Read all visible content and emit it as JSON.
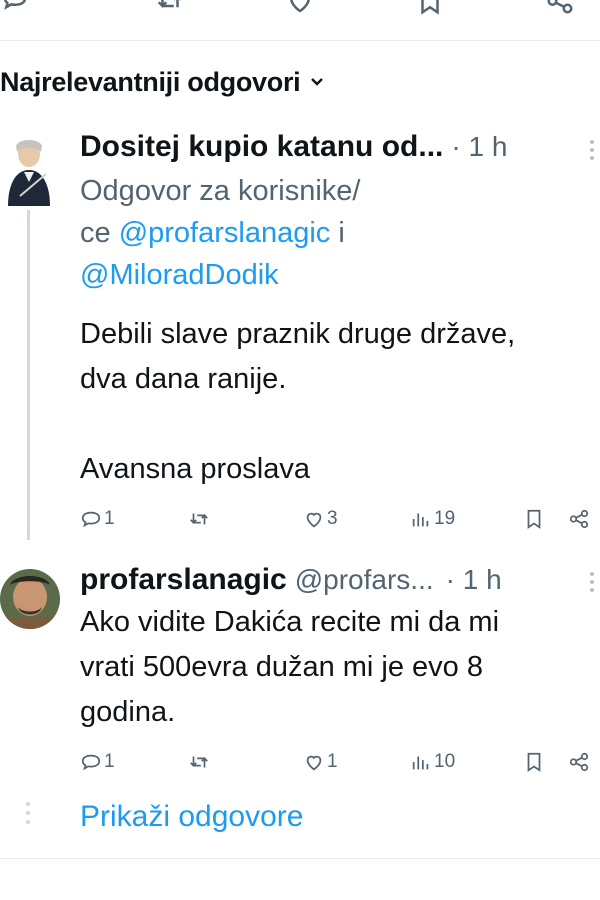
{
  "sort": {
    "label": "Najrelevantniji odgovori"
  },
  "replies": [
    {
      "display_name": "Dositej kupio katanu od...",
      "time": "· 1 h",
      "replying_prefix_line1": "Odgovor za korisnike/",
      "replying_prefix_line2": "ce ",
      "mention1": "@profarslanagic",
      "connector": " i",
      "mention2": "@MiloradDodik",
      "text_line1": "Debili slave praznik druge države,",
      "text_line2": "dva dana ranije.",
      "text_line3": "Avansna proslava",
      "stats": {
        "replies": "1",
        "likes": "3",
        "views": "19"
      }
    },
    {
      "display_name": "profarslanagic",
      "handle": "@profars...",
      "time": "· 1 h",
      "text_line1": "Ako vidite Dakića recite mi da mi",
      "text_line2": "vrati 500evra dužan mi je evo 8",
      "text_line3": "godina.",
      "stats": {
        "replies": "1",
        "likes": "1",
        "views": "10"
      }
    }
  ],
  "show_replies_label": "Prikaži odgovore",
  "colors": {
    "accent": "#1d9bf0",
    "text": "#0f1419",
    "muted": "#536471",
    "thread": "#cfd9de"
  }
}
